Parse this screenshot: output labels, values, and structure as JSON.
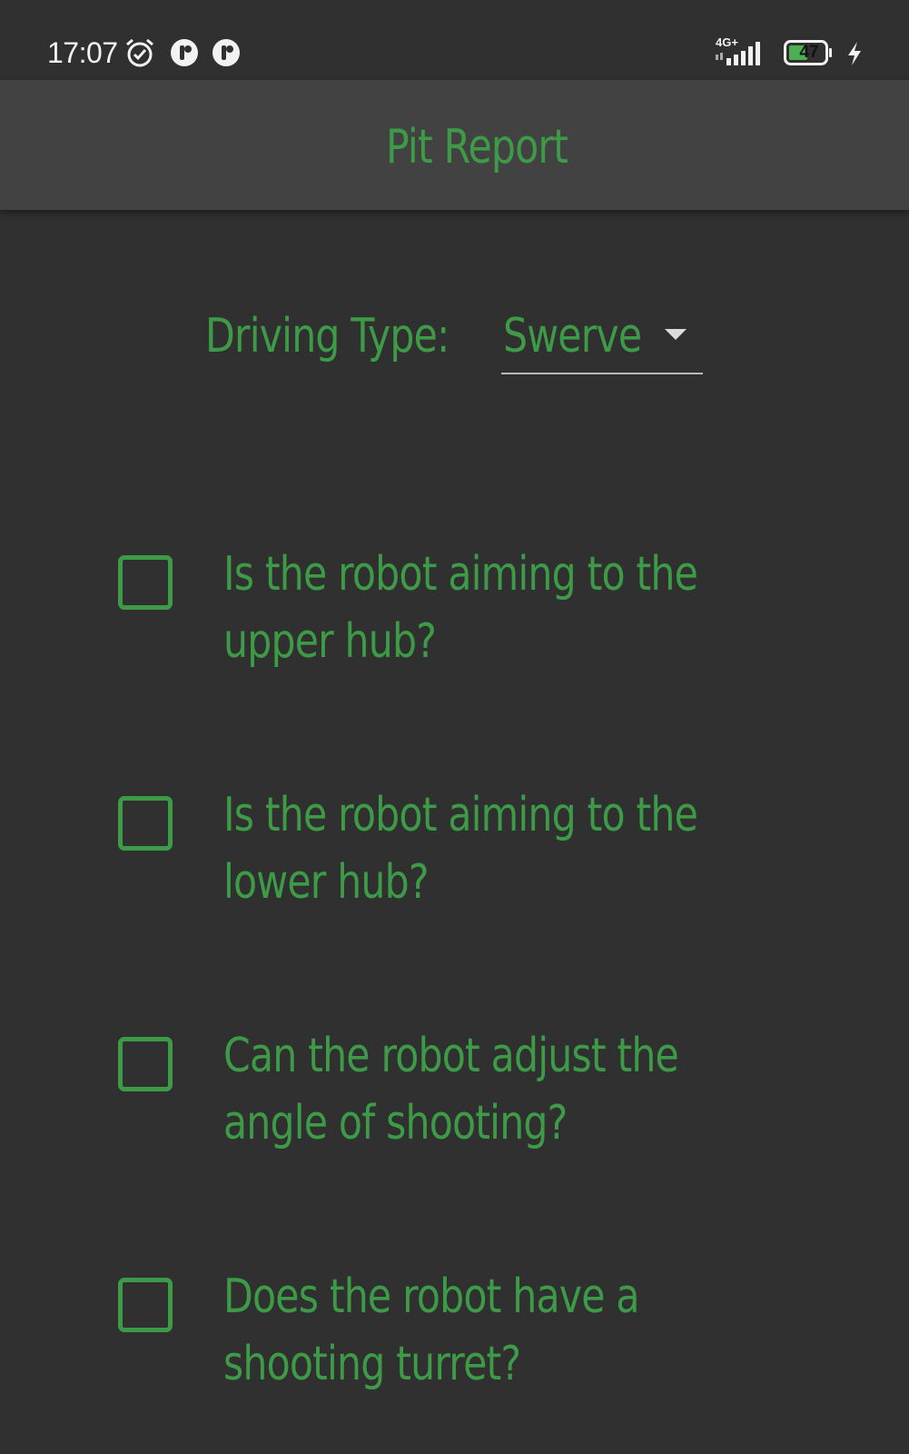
{
  "status_bar": {
    "time": "17:07",
    "network": "4G+",
    "battery_level": "47",
    "icons": [
      "alarm-icon",
      "notification-app-icon",
      "notification-app-icon",
      "signal-icon",
      "battery-icon",
      "charging-icon"
    ]
  },
  "app_bar": {
    "title": "Pit Report"
  },
  "driving_type": {
    "label": "Driving Type:",
    "selected": "Swerve"
  },
  "questions": [
    {
      "text": "Is the robot aiming to the upper hub?",
      "checked": false
    },
    {
      "text": "Is the robot aiming to the lower hub?",
      "checked": false
    },
    {
      "text": "Can the robot adjust the angle of shooting?",
      "checked": false
    },
    {
      "text": "Does the robot have a shooting turret?",
      "checked": false
    }
  ],
  "colors": {
    "accent": "#3d9b47",
    "background": "#303030",
    "app_bar": "#424242"
  }
}
